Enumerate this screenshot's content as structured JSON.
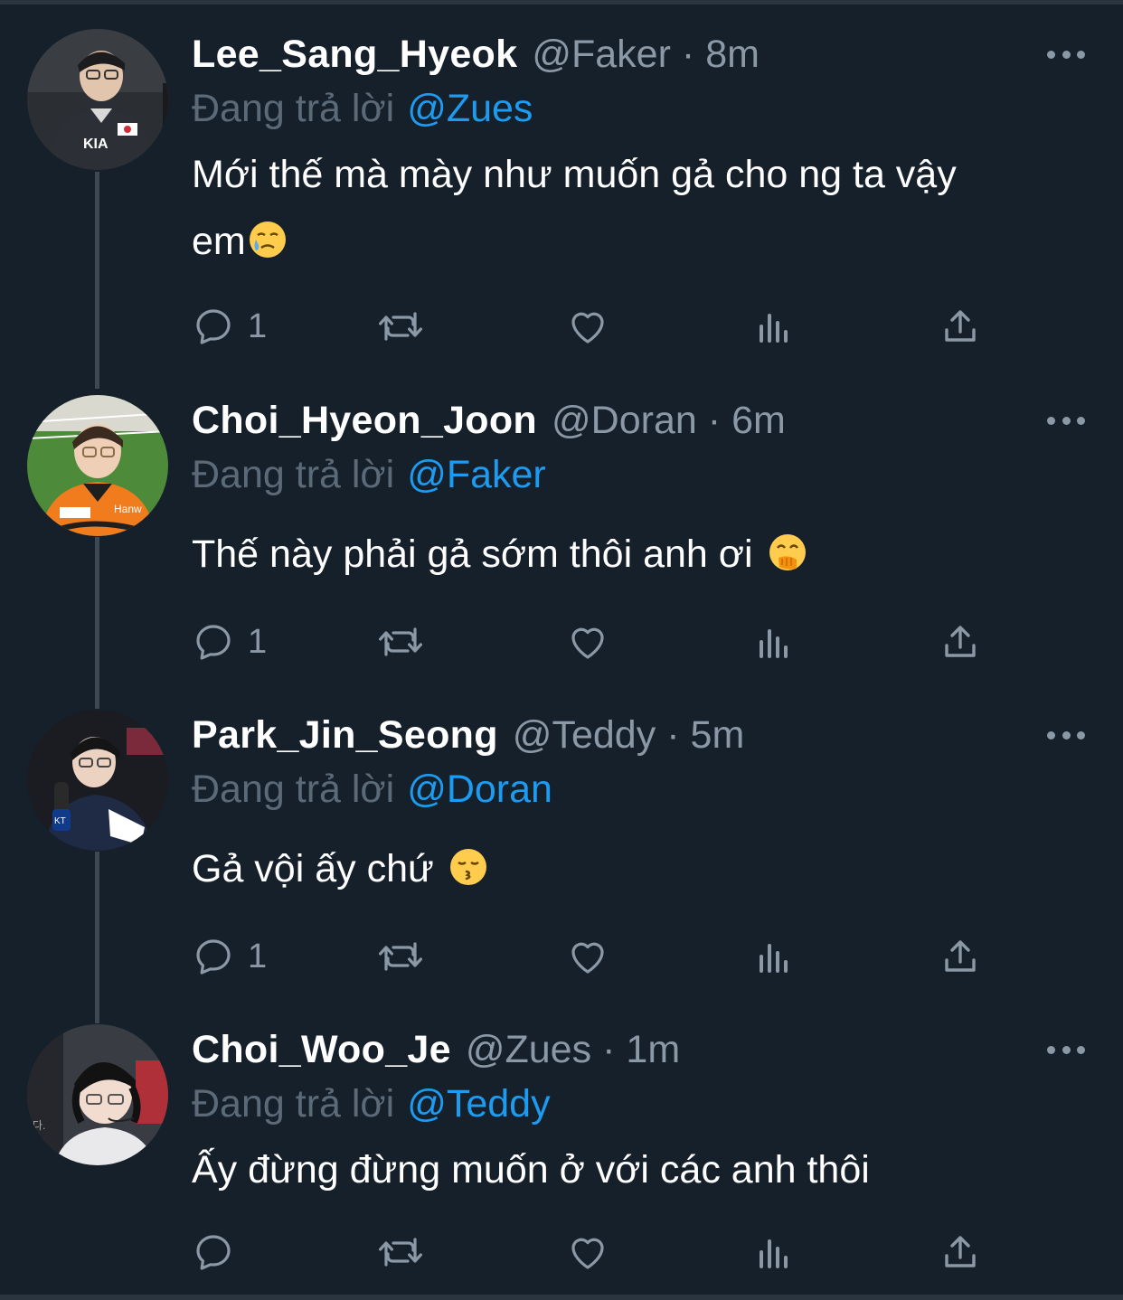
{
  "colors": {
    "background": "#15202b",
    "text_primary": "#ffffff",
    "text_secondary": "#8b98a5",
    "mention": "#1d9bf0",
    "thread_line": "#3d4852"
  },
  "tweets": [
    {
      "display_name": "Lee_Sang_Hyeok",
      "handle": "@Faker",
      "separator": "·",
      "time": "8m",
      "reply_prefix": "Đang trả lời",
      "reply_to": "@Zues",
      "text_line1": "Mới thế mà mày như muốn gả cho ng ta vậy",
      "text_line2": "em",
      "emoji": "face-holding-back-tears-icon",
      "reply_count": "1",
      "more_icon": "more-horizontal-icon"
    },
    {
      "display_name": "Choi_Hyeon_Joon",
      "handle": "@Doran",
      "separator": "·",
      "time": "6m",
      "reply_prefix": "Đang trả lời",
      "reply_to": "@Faker",
      "text_line1": "Thế này phải gả sớm thôi anh ơi",
      "emoji": "face-with-hand-over-mouth-icon",
      "reply_count": "1",
      "more_icon": "more-horizontal-icon"
    },
    {
      "display_name": "Park_Jin_Seong",
      "handle": "@Teddy",
      "separator": "·",
      "time": "5m",
      "reply_prefix": "Đang trả lời",
      "reply_to": "@Doran",
      "text_line1": "Gả vội ấy chứ",
      "emoji": "kissing-face-icon",
      "reply_count": "1",
      "more_icon": "more-horizontal-icon"
    },
    {
      "display_name": "Choi_Woo_Je",
      "handle": "@Zues",
      "separator": "·",
      "time": "1m",
      "reply_prefix": "Đang trả lời",
      "reply_to": "@Teddy",
      "text_line1": "Ấy đừng đừng muốn ở với các anh thôi",
      "reply_count": "",
      "more_icon": "more-horizontal-icon"
    }
  ]
}
